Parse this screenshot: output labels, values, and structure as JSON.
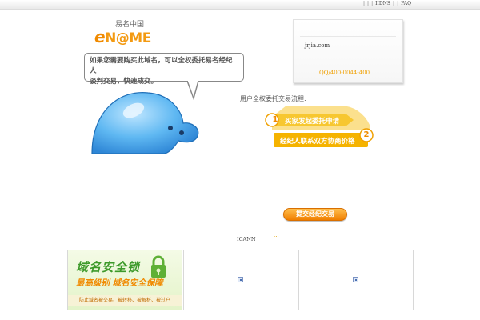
{
  "topnav": {
    "items": [
      "|",
      "|",
      "|",
      "IIDNS",
      "|",
      "|",
      "FAQ"
    ]
  },
  "logo": {
    "brand_e": "e",
    "brand_rest": "N@ME",
    "chinese": "易名中国",
    "colors": {
      "orange": "#f39a12"
    }
  },
  "bubble": {
    "line1": "如果您需要购买此域名，可以全权委托易名经纪人",
    "line2": "谈判交易，快速成交。"
  },
  "infobox": {
    "domain": "jrjia.com",
    "contact": "QQ/400-0044-400"
  },
  "flow": {
    "title": "用户全权委托交易流程:",
    "step1_num": "1",
    "step1": "买家发起委托申请",
    "step2_num": "2",
    "step2": "经纪人联系双方协商价格"
  },
  "submit": {
    "label": "提交经纪交易"
  },
  "footer": {
    "icann": "ICANN",
    "dots": "···"
  },
  "panel1": {
    "title": "域名安全锁",
    "subtitle": "最高级别 域名安全保障",
    "note": "防止域名被交易、被转移、被解析、被过户"
  },
  "icons": {
    "lock": "padlock-icon",
    "broken_image": "broken-image-icon",
    "mascot": "blue-blob-mascot"
  },
  "colors": {
    "accent": "#f08a00",
    "green": "#3d9a2a",
    "flow_yellow": "#f7c730"
  }
}
